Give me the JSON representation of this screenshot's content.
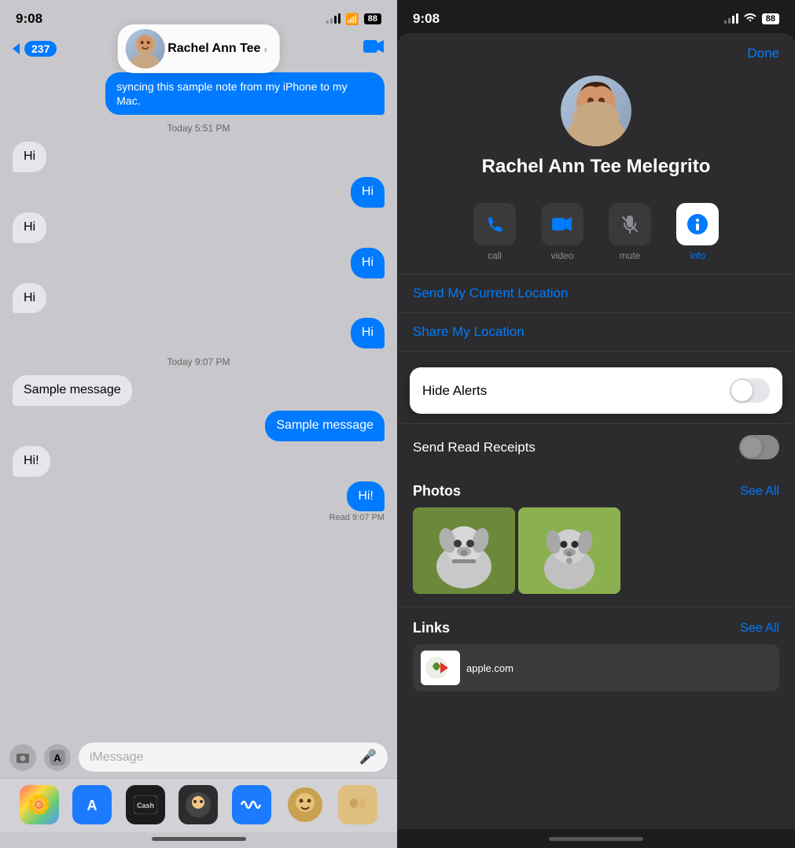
{
  "left": {
    "status": {
      "time": "9:08",
      "battery": "88"
    },
    "nav": {
      "back_count": "237",
      "contact_name": "Rachel Ann Tee",
      "chevron": "›"
    },
    "messages": [
      {
        "type": "timestamp",
        "text": "syncing this sample note from my iPhone to my Mac."
      },
      {
        "type": "timestamp_label",
        "text": "Today 5:51 PM"
      },
      {
        "type": "received",
        "text": "Hi"
      },
      {
        "type": "sent",
        "text": "Hi"
      },
      {
        "type": "received",
        "text": "Hi"
      },
      {
        "type": "sent",
        "text": "Hi"
      },
      {
        "type": "received",
        "text": "Hi"
      },
      {
        "type": "sent",
        "text": "Hi"
      },
      {
        "type": "timestamp_label",
        "text": "Today 9:07 PM"
      },
      {
        "type": "received",
        "text": "Sample message"
      },
      {
        "type": "sent",
        "text": "Sample message"
      },
      {
        "type": "received",
        "text": "Hi!"
      },
      {
        "type": "sent",
        "text": "Hi!"
      },
      {
        "type": "read_label",
        "text": "Read 9:07 PM"
      }
    ],
    "input": {
      "placeholder": "iMessage"
    },
    "app_icons": [
      "📷",
      "🅐",
      "💳",
      "🎯",
      "〰",
      "😄",
      "🎭"
    ]
  },
  "right": {
    "status": {
      "time": "9:08",
      "battery": "88"
    },
    "done_label": "Done",
    "contact": {
      "full_name": "Rachel Ann Tee Melegrito"
    },
    "actions": [
      {
        "label": "call",
        "icon": "📞",
        "highlighted": false
      },
      {
        "label": "video",
        "icon": "📹",
        "highlighted": false
      },
      {
        "label": "mute",
        "icon": "🔕",
        "highlighted": false
      },
      {
        "label": "info",
        "icon": "👤",
        "highlighted": true
      }
    ],
    "location": {
      "send_location": "Send My Current Location",
      "share_location": "Share My Location"
    },
    "hide_alerts": {
      "label": "Hide Alerts",
      "enabled": false
    },
    "send_read_receipts": {
      "label": "Send Read Receipts",
      "enabled": false
    },
    "photos": {
      "title": "Photos",
      "see_all": "See All"
    },
    "links": {
      "title": "Links",
      "see_all": "See All"
    }
  }
}
